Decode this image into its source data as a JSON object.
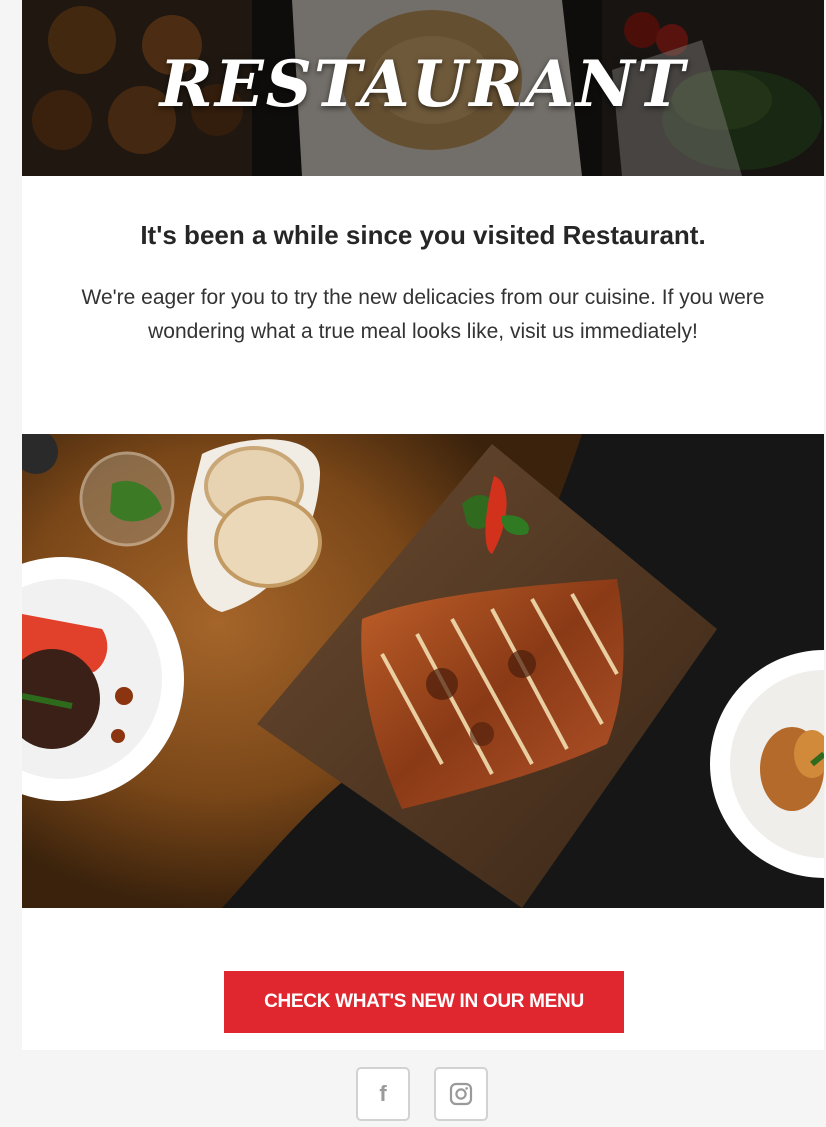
{
  "header": {
    "brand": "RESTAURANT"
  },
  "intro": {
    "heading": "It's been a while since you visited Restaurant.",
    "body": "We're eager for you to try the new delicacies from our cuisine. If you were wondering what a true meal looks like, visit us immediately!"
  },
  "cta": {
    "label": "CHECK WHAT'S NEW IN OUR MENU"
  },
  "footer": {
    "social": [
      {
        "icon": "facebook-icon",
        "glyph": "f"
      },
      {
        "icon": "instagram-icon",
        "glyph": ""
      }
    ]
  },
  "colors": {
    "accent": "#e0272f",
    "page_bg": "#f5f5f5",
    "card_bg": "#ffffff"
  }
}
